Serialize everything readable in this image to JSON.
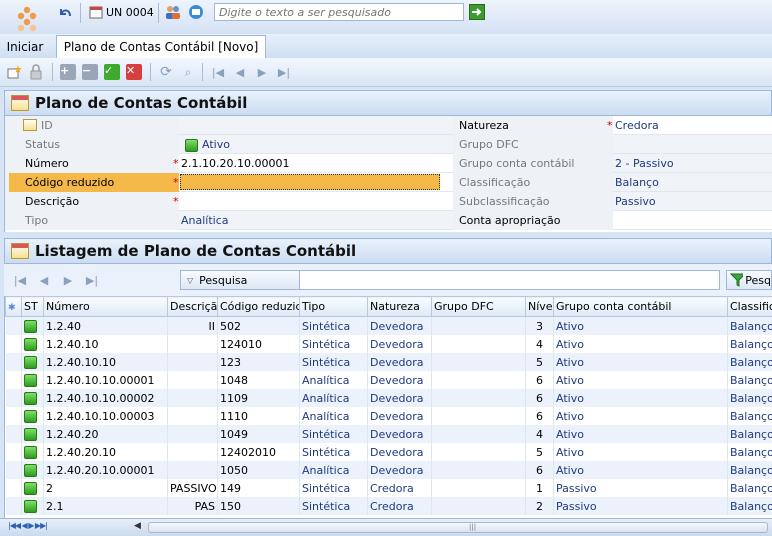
{
  "topbar": {
    "unit_label": "UN 0004",
    "search_placeholder": "Digite o texto a ser pesquisado"
  },
  "menu": {
    "start_label": "Iniciar",
    "tab_label": "Plano de Contas Contábil [Novo]"
  },
  "form": {
    "title": "Plano de Contas Contábil",
    "left": [
      {
        "label": "ID",
        "value": "",
        "required": false,
        "gray": true
      },
      {
        "label": "Status",
        "value": "Ativo",
        "required": false,
        "gray": true
      },
      {
        "label": "Número",
        "value": "2.1.10.20.10.00001",
        "required": true,
        "gray": false
      },
      {
        "label": "Código reduzido",
        "value": "",
        "required": true,
        "gray": false
      },
      {
        "label": "Descrição",
        "value": "",
        "required": true,
        "gray": false
      },
      {
        "label": "Tipo",
        "value": "Analítica",
        "required": false,
        "gray": true
      }
    ],
    "right": [
      {
        "label": "Natureza",
        "value": "Credora",
        "required": true
      },
      {
        "label": "Grupo DFC",
        "value": "",
        "required": false
      },
      {
        "label": "Grupo conta contábil",
        "value": "2 - Passivo",
        "required": false
      },
      {
        "label": "Classificação",
        "value": "Balanço",
        "required": false
      },
      {
        "label": "Subclassificação",
        "value": "Passivo",
        "required": false
      },
      {
        "label": "Conta apropriação",
        "value": "",
        "required": false
      }
    ]
  },
  "list": {
    "title": "Listagem de Plano de Contas Contábil",
    "search_label": "Pesquisa",
    "search_button": "Pesq",
    "columns": [
      "ST",
      "Número",
      "Descrição",
      "Código reduzido",
      "Tipo",
      "Natureza",
      "Grupo DFC",
      "Nível",
      "Grupo conta contábil",
      "Classifica"
    ],
    "rows": [
      {
        "numero": "1.2.40",
        "descricao": "II",
        "codigo": "502",
        "tipo": "Sintética",
        "natureza": "Devedora",
        "dfc": "",
        "nivel": "3",
        "grupo": "Ativo",
        "class": "Balanço"
      },
      {
        "numero": "1.2.40.10",
        "descricao": "",
        "codigo": "124010",
        "tipo": "Sintética",
        "natureza": "Devedora",
        "dfc": "",
        "nivel": "4",
        "grupo": "Ativo",
        "class": "Balanço"
      },
      {
        "numero": "1.2.40.10.10",
        "descricao": "",
        "codigo": "123",
        "tipo": "Sintética",
        "natureza": "Devedora",
        "dfc": "",
        "nivel": "5",
        "grupo": "Ativo",
        "class": "Balanço"
      },
      {
        "numero": "1.2.40.10.10.00001",
        "descricao": "",
        "codigo": "1048",
        "tipo": "Analítica",
        "natureza": "Devedora",
        "dfc": "",
        "nivel": "6",
        "grupo": "Ativo",
        "class": "Balanço"
      },
      {
        "numero": "1.2.40.10.10.00002",
        "descricao": "",
        "codigo": "1109",
        "tipo": "Analítica",
        "natureza": "Devedora",
        "dfc": "",
        "nivel": "6",
        "grupo": "Ativo",
        "class": "Balanço"
      },
      {
        "numero": "1.2.40.10.10.00003",
        "descricao": "",
        "codigo": "1110",
        "tipo": "Analítica",
        "natureza": "Devedora",
        "dfc": "",
        "nivel": "6",
        "grupo": "Ativo",
        "class": "Balanço"
      },
      {
        "numero": "1.2.40.20",
        "descricao": "",
        "codigo": "1049",
        "tipo": "Sintética",
        "natureza": "Devedora",
        "dfc": "",
        "nivel": "4",
        "grupo": "Ativo",
        "class": "Balanço"
      },
      {
        "numero": "1.2.40.20.10",
        "descricao": "",
        "codigo": "12402010",
        "tipo": "Sintética",
        "natureza": "Devedora",
        "dfc": "",
        "nivel": "5",
        "grupo": "Ativo",
        "class": "Balanço"
      },
      {
        "numero": "1.2.40.20.10.00001",
        "descricao": "",
        "codigo": "1050",
        "tipo": "Analítica",
        "natureza": "Devedora",
        "dfc": "",
        "nivel": "6",
        "grupo": "Ativo",
        "class": "Balanço"
      },
      {
        "numero": "2",
        "descricao": "PASSIVO",
        "codigo": "149",
        "tipo": "Sintética",
        "natureza": "Credora",
        "dfc": "",
        "nivel": "1",
        "grupo": "Passivo",
        "class": "Balanço"
      },
      {
        "numero": "2.1",
        "descricao": "PAS",
        "codigo": "150",
        "tipo": "Sintética",
        "natureza": "Credora",
        "dfc": "",
        "nivel": "2",
        "grupo": "Passivo",
        "class": "Balanço"
      }
    ]
  },
  "colors": {
    "accent_blue": "#1f3a80",
    "status_green": "#2e9c1e",
    "highlight_orange": "#f5b94a"
  }
}
